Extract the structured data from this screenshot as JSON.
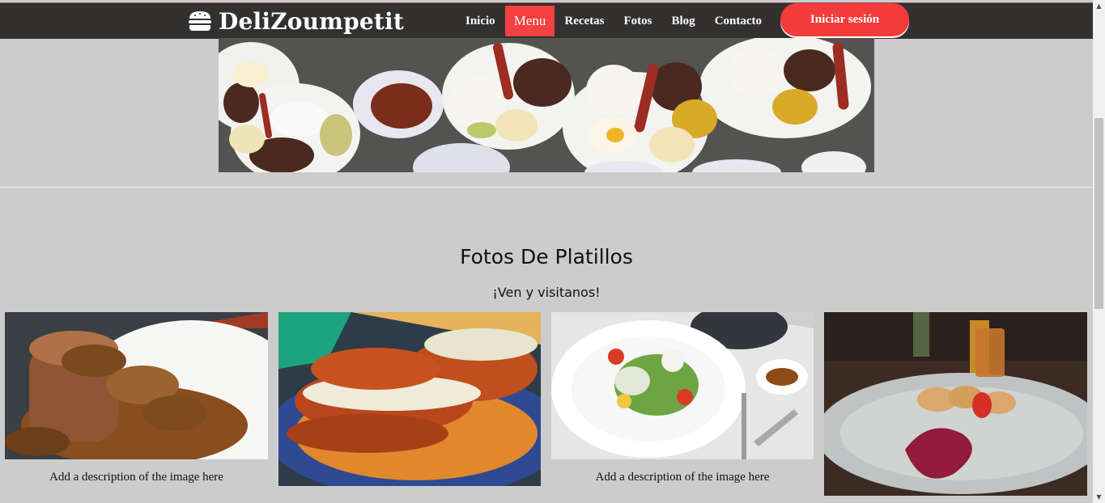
{
  "brand": {
    "name": "DeliZoumpetit"
  },
  "nav": {
    "items": [
      {
        "label": "Inicio",
        "active": false
      },
      {
        "label": "Menu",
        "active": true
      },
      {
        "label": "Recetas",
        "active": false
      },
      {
        "label": "Fotos",
        "active": false
      },
      {
        "label": "Blog",
        "active": false
      },
      {
        "label": "Contacto",
        "active": false
      }
    ],
    "login_label": "Iniciar sesión"
  },
  "colors": {
    "navbar": "#333030",
    "accent": "#f44040",
    "background": "#cccccc"
  },
  "section": {
    "title": "Fotos De Platillos",
    "subtitle": "¡Ven y visitanos!"
  },
  "gallery": [
    {
      "caption": "Add a description of the image here"
    },
    {
      "caption": ""
    },
    {
      "caption": "Add a description of the image here"
    },
    {
      "caption": ""
    }
  ]
}
